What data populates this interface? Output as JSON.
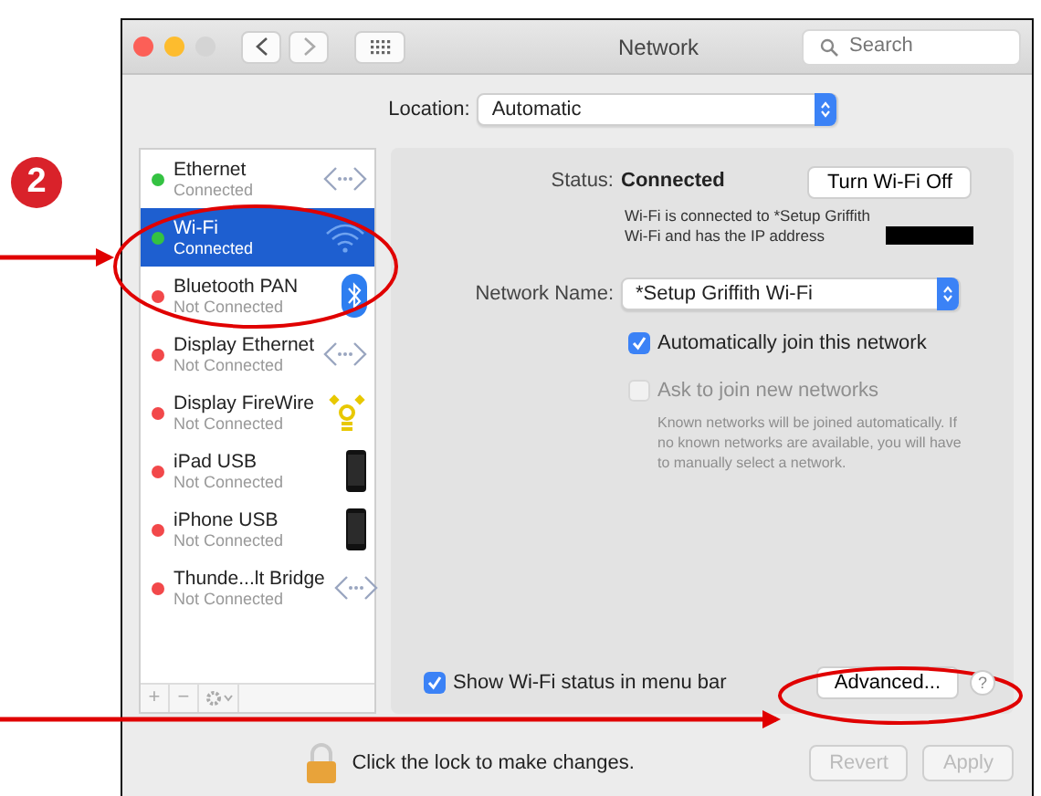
{
  "annotation": {
    "step": "2"
  },
  "window": {
    "title": "Network",
    "search": {
      "placeholder": "Search"
    }
  },
  "location": {
    "label": "Location:",
    "value": "Automatic"
  },
  "services": [
    {
      "name": "Ethernet",
      "status": "Connected",
      "color": "#34c242",
      "kind": "ethernet",
      "selected": false
    },
    {
      "name": "Wi-Fi",
      "status": "Connected",
      "color": "#34c242",
      "kind": "wifi",
      "selected": true
    },
    {
      "name": "Bluetooth PAN",
      "status": "Not Connected",
      "color": "#f2484a",
      "kind": "bluetooth",
      "selected": false
    },
    {
      "name": "Display Ethernet",
      "status": "Not Connected",
      "color": "#f2484a",
      "kind": "ethernet",
      "selected": false
    },
    {
      "name": "Display FireWire",
      "status": "Not Connected",
      "color": "#f2484a",
      "kind": "firewire",
      "selected": false
    },
    {
      "name": "iPad USB",
      "status": "Not Connected",
      "color": "#f2484a",
      "kind": "device",
      "selected": false
    },
    {
      "name": "iPhone USB",
      "status": "Not Connected",
      "color": "#f2484a",
      "kind": "device",
      "selected": false
    },
    {
      "name": "Thunde...lt Bridge",
      "status": "Not Connected",
      "color": "#f2484a",
      "kind": "ethernet",
      "selected": false
    }
  ],
  "service_tools": [
    "+",
    "−"
  ],
  "detail": {
    "status_label": "Status:",
    "status_value": "Connected",
    "toggle_button": "Turn Wi-Fi Off",
    "status_note": "Wi-Fi is connected to *Setup Griffith Wi-Fi and has the IP address",
    "network_label": "Network Name:",
    "network_value": "*Setup Griffith Wi-Fi",
    "options": [
      {
        "label": "Automatically join this network",
        "checked": true,
        "disabled": false
      },
      {
        "label": "Ask to join new networks",
        "checked": false,
        "disabled": true
      }
    ],
    "hint": "Known networks will be joined automatically. If no known networks are available, you will have to manually select a network.",
    "menu_bar_option": {
      "label": "Show Wi-Fi status in menu bar",
      "checked": true
    },
    "advanced_button": "Advanced...",
    "help_button": "?"
  },
  "lock_text": "Click the lock to make changes.",
  "buttons": [
    {
      "label": "Revert",
      "disabled": true
    },
    {
      "label": "Apply",
      "disabled": true
    }
  ]
}
